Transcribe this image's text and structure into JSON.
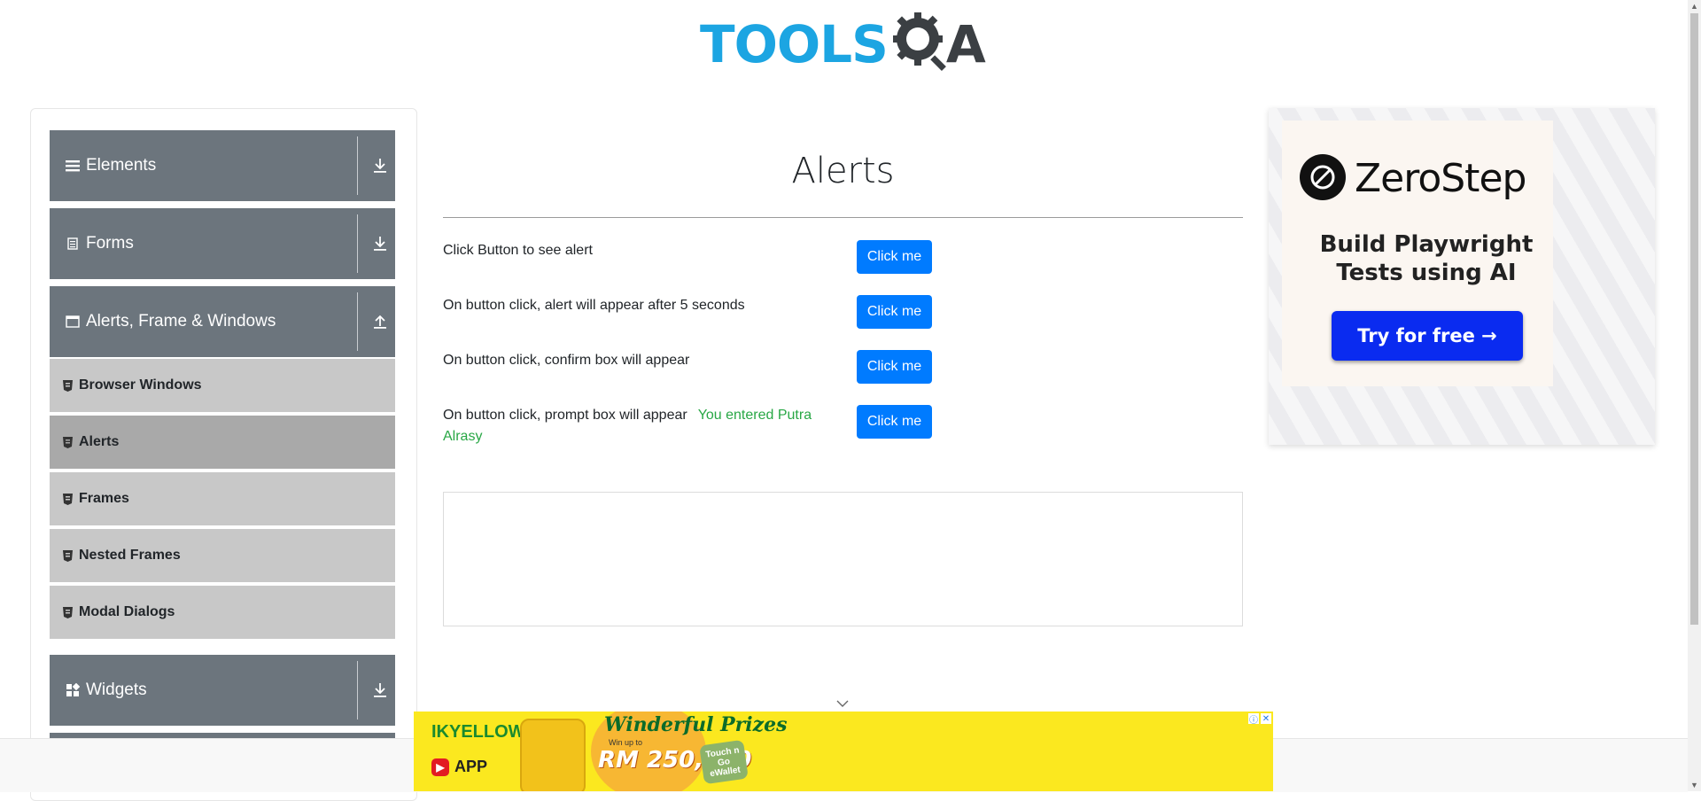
{
  "header": {
    "logo_text": "TOOLS",
    "logo_suffix": "A"
  },
  "sidebar": {
    "groups": [
      {
        "label": "Elements",
        "icon": "hamburger-icon",
        "state": "collapsed"
      },
      {
        "label": "Forms",
        "icon": "document-icon",
        "state": "collapsed"
      },
      {
        "label": "Alerts, Frame & Windows",
        "icon": "window-icon",
        "state": "expanded"
      },
      {
        "label": "Widgets",
        "icon": "widgets-icon",
        "state": "collapsed"
      }
    ],
    "items": [
      {
        "label": "Browser Windows",
        "active": false
      },
      {
        "label": "Alerts",
        "active": true
      },
      {
        "label": "Frames",
        "active": false
      },
      {
        "label": "Nested Frames",
        "active": false
      },
      {
        "label": "Modal Dialogs",
        "active": false
      }
    ]
  },
  "main": {
    "title": "Alerts",
    "rows": [
      {
        "text": "Click Button to see alert",
        "button": "Click me"
      },
      {
        "text": "On button click, alert will appear after 5 seconds",
        "button": "Click me"
      },
      {
        "text": "On button click, confirm box will appear",
        "button": "Click me"
      },
      {
        "text": "On button click, prompt box will appear",
        "result": "You entered Putra Alrasy",
        "button": "Click me"
      }
    ]
  },
  "ad_right": {
    "brand": "ZeroStep",
    "tagline": "Build Playwright Tests using AI",
    "cta": "Try for free →"
  },
  "ad_bottom": {
    "brand": "IKYELLOW",
    "app": "APP",
    "headline": "Winderful Prizes",
    "subline": "Win up to",
    "amount": "RM 250,000",
    "badge": "Touch n Go eWallet",
    "info_icon": "ⓘ",
    "close_icon": "✕"
  },
  "colors": {
    "accent": "#007bff",
    "sidebar_header": "#6c757d",
    "success": "#28a745",
    "logo_blue": "#1ca5e2"
  }
}
